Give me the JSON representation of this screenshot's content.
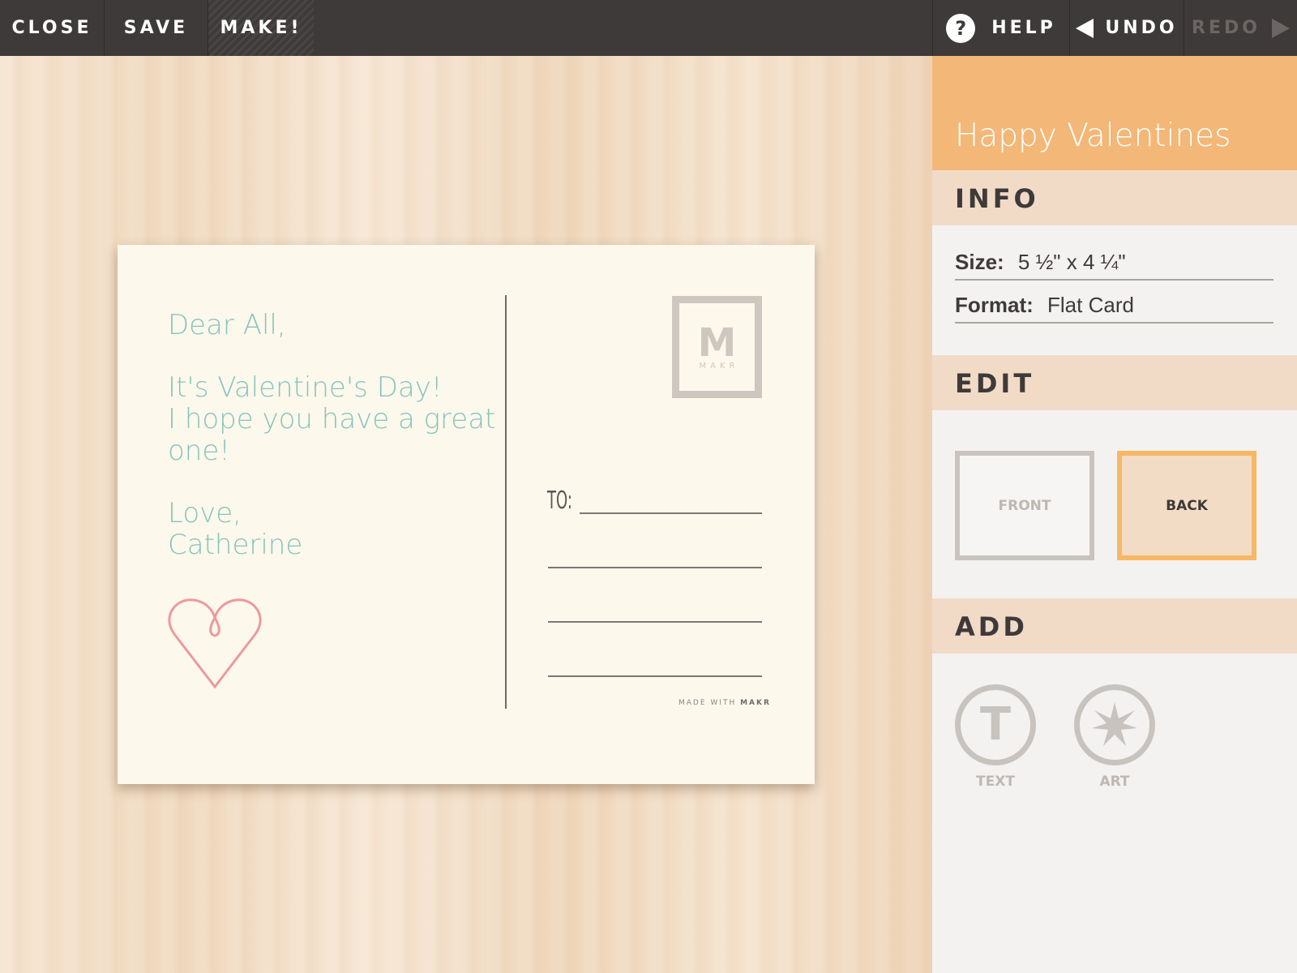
{
  "toolbar": {
    "close_label": "CLOSE",
    "save_label": "SAVE",
    "make_label": "MAKE!",
    "help_icon_glyph": "?",
    "help_label": "HELP",
    "undo_label": "UNDO",
    "redo_label": "REDO"
  },
  "card": {
    "greeting": "Dear All,",
    "message_line1": "It's Valentine's Day!",
    "message_line2": "I hope you have a great",
    "message_line3": "one!",
    "signoff": "Love,",
    "signature": "Catherine",
    "stamp_letter": "M",
    "stamp_text": "MAKR",
    "to_label": "TO:",
    "made_with_prefix": "MADE WITH",
    "made_with_brand": "MAKR",
    "heart_color": "#ec9a9c",
    "text_color": "#86c4bd"
  },
  "panel": {
    "title": "Happy Valentines",
    "info_heading": "INFO",
    "size_label": "Size:",
    "size_value": "5 ½\" x 4 ¼\"",
    "format_label": "Format:",
    "format_value": "Flat Card",
    "edit_heading": "EDIT",
    "front_label": "FRONT",
    "back_label": "BACK",
    "add_heading": "ADD",
    "text_label": "TEXT",
    "art_label": "ART",
    "text_icon_glyph": "T",
    "accent_color": "#f3b777"
  },
  "icons": [
    "help-icon",
    "undo-arrow-icon",
    "redo-arrow-icon",
    "heart-icon",
    "makr-stamp-icon",
    "text-icon",
    "art-star-icon"
  ]
}
